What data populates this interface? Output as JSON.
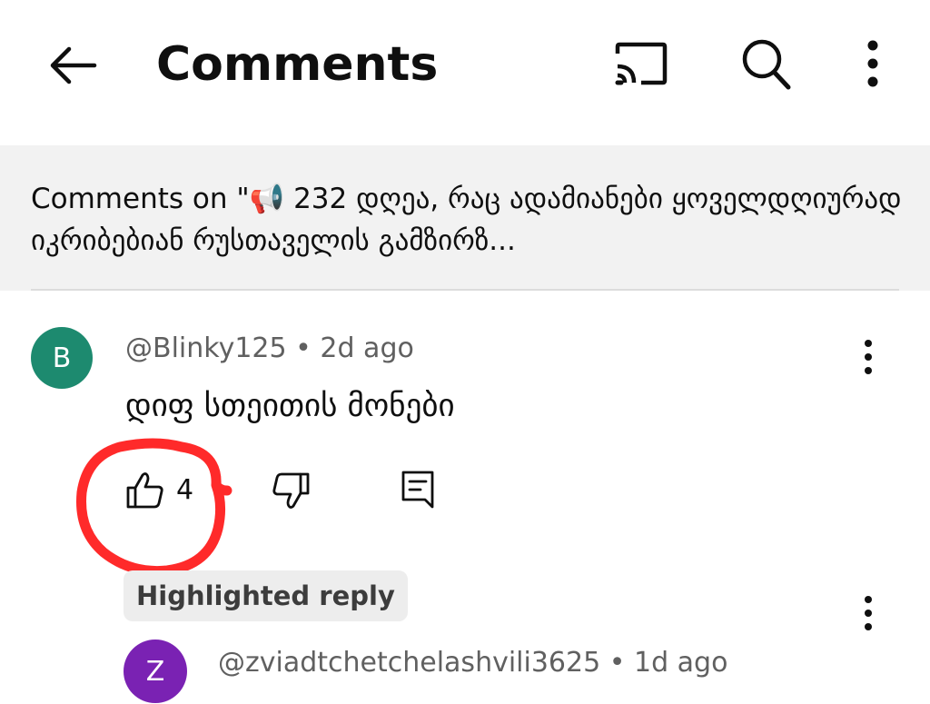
{
  "header": {
    "title": "Comments",
    "icons": {
      "back": "arrow-left-icon",
      "cast": "cast-icon",
      "search": "search-icon",
      "more": "more-vertical-icon"
    }
  },
  "context": {
    "prefix": "Comments on \"",
    "emoji": "📢",
    "text": " 232 დღეა, რაც ადამიანები ყოველდღიურად იკრიბებიან რუსთაველის გამზირზ..."
  },
  "comments": [
    {
      "avatar_letter": "B",
      "avatar_color": "#1d8a6f",
      "author": "@Blinky125",
      "separator": "•",
      "time": "2d ago",
      "text": "დიფ სთეითის მონები",
      "likes": "4"
    }
  ],
  "highlight": {
    "label": "Highlighted reply"
  },
  "reply": {
    "avatar_letter": "Z",
    "avatar_color": "#7a22b3",
    "author": "@zviadtchetchelashvili3625",
    "separator": "•",
    "time": "1d ago"
  },
  "colors": {
    "annotation": "#ff2a2a",
    "context_bg": "#f2f2f2",
    "meta_text": "#606060"
  }
}
